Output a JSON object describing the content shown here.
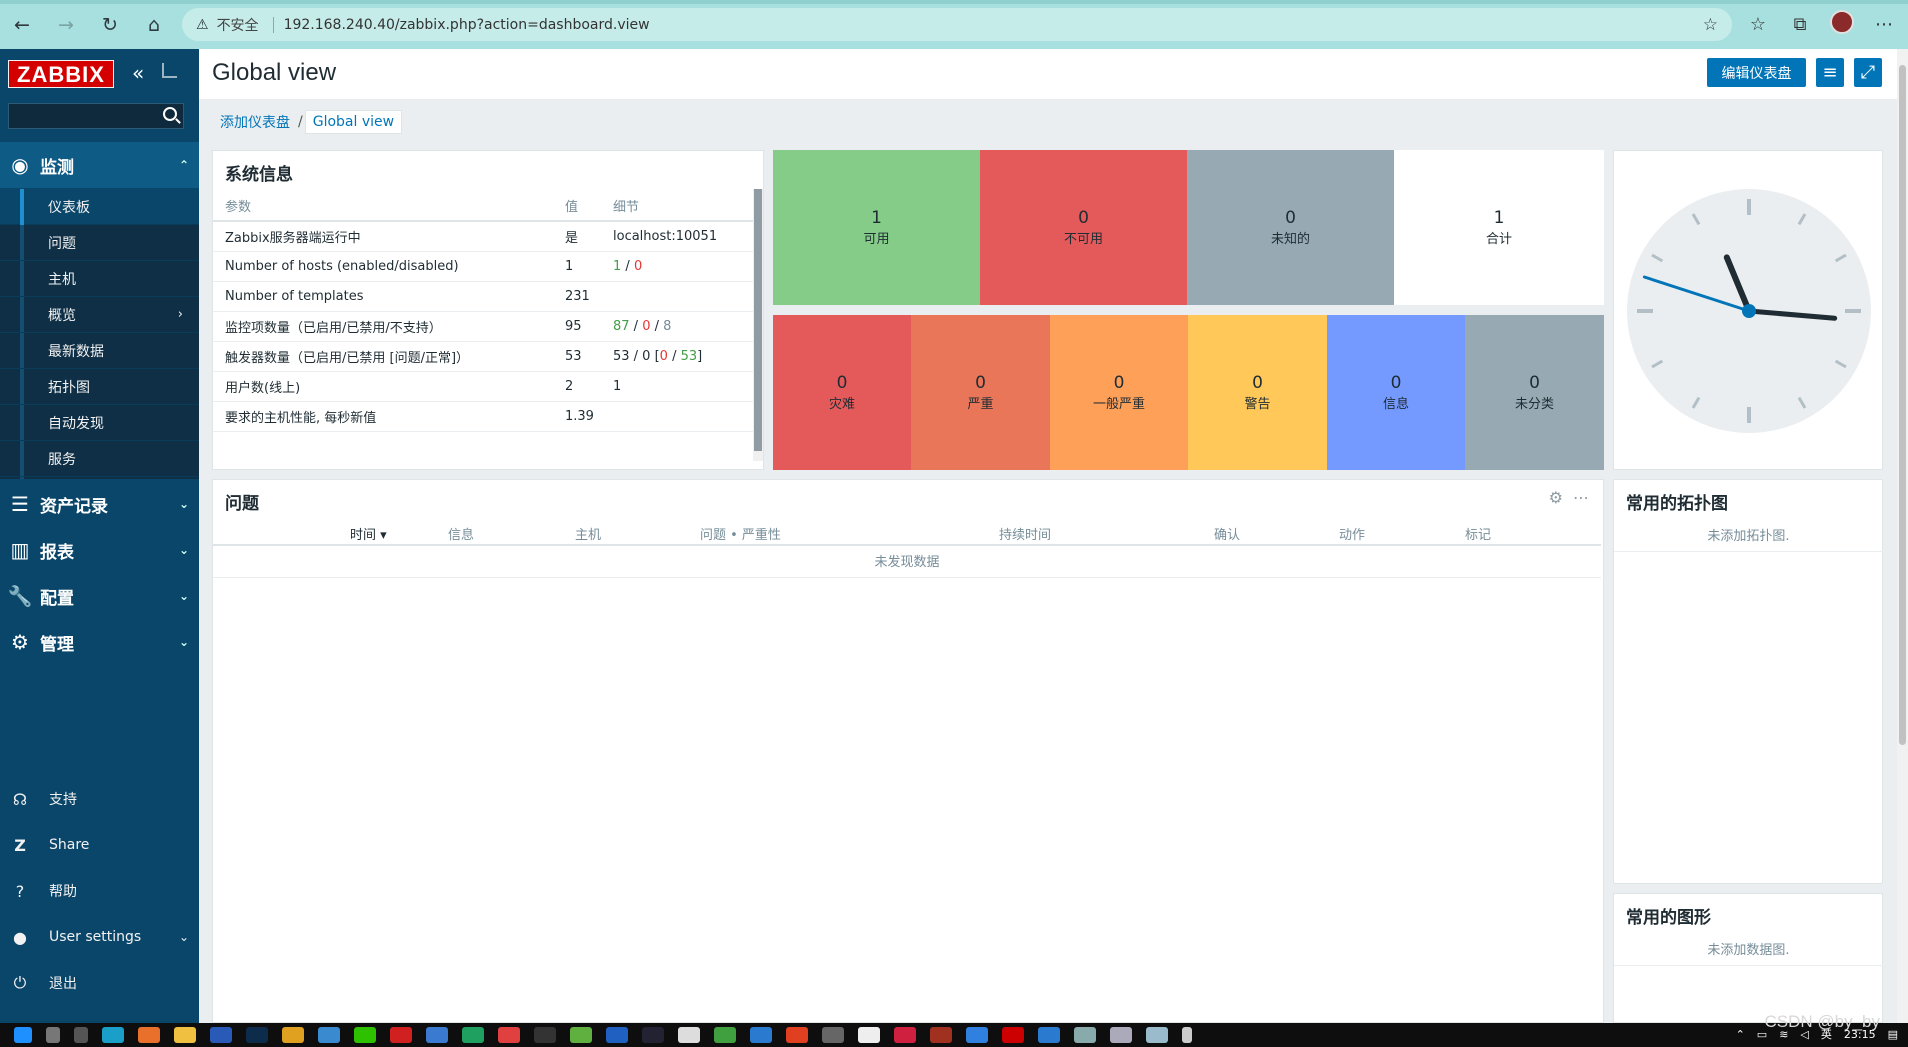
{
  "browser": {
    "security_label": "不安全",
    "url": "192.168.240.40/zabbix.php?action=dashboard.view"
  },
  "sidebar": {
    "logo": "ZABBIX",
    "sections": [
      {
        "label": "监测",
        "icon": "eye-icon",
        "expanded": true
      },
      {
        "label": "资产记录",
        "icon": "list-icon"
      },
      {
        "label": "报表",
        "icon": "bar-chart-icon"
      },
      {
        "label": "配置",
        "icon": "wrench-icon"
      },
      {
        "label": "管理",
        "icon": "gear-icon"
      }
    ],
    "monitoring_items": [
      "仪表板",
      "问题",
      "主机",
      "概览",
      "最新数据",
      "拓扑图",
      "自动发现",
      "服务"
    ],
    "bottom": [
      {
        "label": "支持",
        "icon": "headset-icon"
      },
      {
        "label": "Share",
        "icon": "share-icon"
      },
      {
        "label": "帮助",
        "icon": "help-icon"
      },
      {
        "label": "User settings",
        "icon": "user-icon"
      },
      {
        "label": "退出",
        "icon": "power-icon"
      }
    ]
  },
  "header": {
    "title": "Global view",
    "edit_button": "编辑仪表盘"
  },
  "breadcrumb": {
    "parent": "添加仪表盘",
    "separator": "/",
    "current": "Global view"
  },
  "sysinfo": {
    "title": "系统信息",
    "columns": [
      "参数",
      "值",
      "细节"
    ],
    "rows": [
      {
        "param": "Zabbix服务器端运行中",
        "value": "是",
        "detail": "localhost:10051"
      },
      {
        "param": "Number of hosts (enabled/disabled)",
        "value": "1",
        "d1": "1",
        "d2": "0"
      },
      {
        "param": "Number of templates",
        "value": "231",
        "detail": ""
      },
      {
        "param": "监控项数量（已启用/已禁用/不支持）",
        "value": "95",
        "d1": "87",
        "d2": "0",
        "d3": "8"
      },
      {
        "param": "触发器数量（已启用/已禁用 [问题/正常]）",
        "value": "53",
        "d1": "53 / 0 [",
        "d2": "0",
        "d3": "53",
        "d4": "]"
      },
      {
        "param": "用户数(线上)",
        "value": "2",
        "detail": "1"
      },
      {
        "param": "要求的主机性能, 每秒新值",
        "value": "1.39",
        "detail": ""
      }
    ]
  },
  "host_availability": [
    {
      "count": "1",
      "label": "可用",
      "color": "#86cc89"
    },
    {
      "count": "0",
      "label": "不可用",
      "color": "#e45959"
    },
    {
      "count": "0",
      "label": "未知的",
      "color": "#97aab3"
    },
    {
      "count": "1",
      "label": "合计",
      "color": "#ffffff"
    }
  ],
  "problems_by_severity": [
    {
      "count": "0",
      "label": "灾难",
      "color": "#e45959"
    },
    {
      "count": "0",
      "label": "严重",
      "color": "#e97659"
    },
    {
      "count": "0",
      "label": "一般严重",
      "color": "#ffa059"
    },
    {
      "count": "0",
      "label": "警告",
      "color": "#ffc859"
    },
    {
      "count": "0",
      "label": "信息",
      "color": "#7499ff"
    },
    {
      "count": "0",
      "label": "未分类",
      "color": "#97aab3"
    }
  ],
  "problems": {
    "title": "问题",
    "columns": [
      "时间 ▾",
      "信息",
      "主机",
      "问题 • 严重性",
      "持续时间",
      "确认",
      "动作",
      "标记"
    ],
    "empty": "未发现数据"
  },
  "fav_maps": {
    "title": "常用的拓扑图",
    "empty": "未添加拓扑图."
  },
  "fav_graphs": {
    "title": "常用的图形",
    "empty": "未添加数据图."
  },
  "clock": {
    "hour": 11,
    "minute": 15,
    "second": 48
  },
  "taskbar": {
    "time": "23:15",
    "ime": "英"
  },
  "watermark": "CSDN @by_by"
}
